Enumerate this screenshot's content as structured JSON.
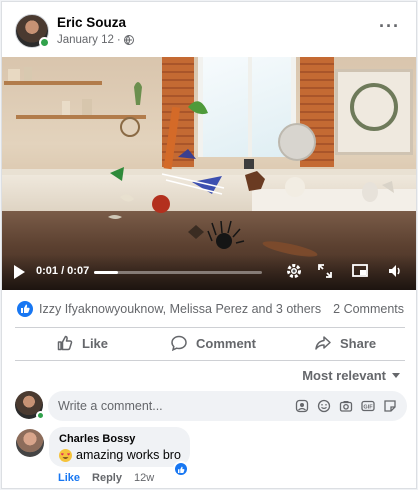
{
  "post": {
    "author": "Eric Souza",
    "date": "January 12",
    "separator": "·",
    "more_label": "···"
  },
  "video": {
    "time_label": "0:01 / 0:07",
    "progress": 0.14
  },
  "reactions": {
    "names": "Izzy Ifyaknowyouknow, Melissa Perez and 3 others",
    "comment_count": "2 Comments"
  },
  "actions": {
    "like": "Like",
    "comment": "Comment",
    "share": "Share"
  },
  "sort": {
    "label": "Most relevant"
  },
  "composer": {
    "placeholder": "Write a comment..."
  },
  "comments": [
    {
      "name": "Charles Bossy",
      "text": "amazing works bro",
      "like_label": "Like",
      "reply_label": "Reply",
      "time": "12w"
    }
  ],
  "colors": {
    "accent": "#1877f2",
    "online": "#31a24c",
    "muted": "#65676b"
  }
}
